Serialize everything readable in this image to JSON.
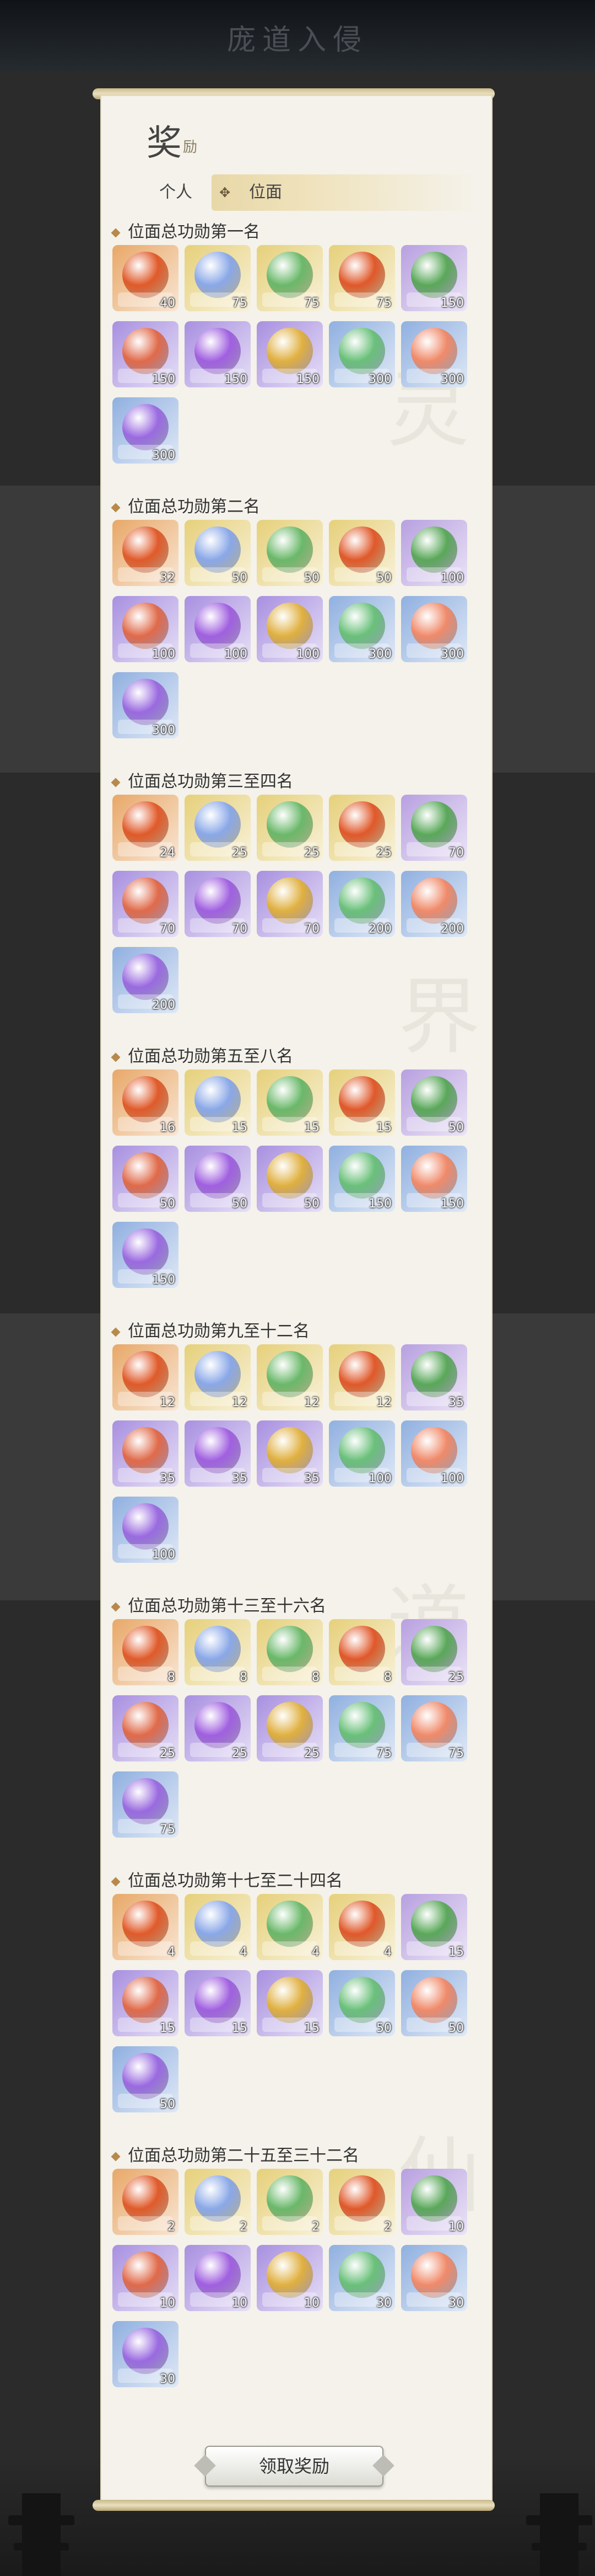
{
  "background_title": "庞道入侵",
  "panel": {
    "title": "奖",
    "subtitle": "励"
  },
  "tabs": [
    {
      "label": "个人",
      "selected": false
    },
    {
      "label": "位面",
      "selected": true,
      "icon": "four-petal-icon"
    }
  ],
  "sections": [
    {
      "title": "位面总功勋第一名",
      "counts": [
        "40",
        "75",
        "75",
        "75",
        "150",
        "150",
        "150",
        "150",
        "300",
        "300",
        "300"
      ]
    },
    {
      "title": "位面总功勋第二名",
      "counts": [
        "32",
        "50",
        "50",
        "50",
        "100",
        "100",
        "100",
        "100",
        "300",
        "300",
        "300"
      ]
    },
    {
      "title": "位面总功勋第三至四名",
      "counts": [
        "24",
        "25",
        "25",
        "25",
        "70",
        "70",
        "70",
        "70",
        "200",
        "200",
        "200"
      ]
    },
    {
      "title": "位面总功勋第五至八名",
      "counts": [
        "16",
        "15",
        "15",
        "15",
        "50",
        "50",
        "50",
        "50",
        "150",
        "150",
        "150"
      ]
    },
    {
      "title": "位面总功勋第九至十二名",
      "counts": [
        "12",
        "12",
        "12",
        "12",
        "35",
        "35",
        "35",
        "35",
        "100",
        "100",
        "100"
      ]
    },
    {
      "title": "位面总功勋第十三至十六名",
      "counts": [
        "8",
        "8",
        "8",
        "8",
        "25",
        "25",
        "25",
        "25",
        "75",
        "75",
        "75"
      ]
    },
    {
      "title": "位面总功勋第十七至二十四名",
      "counts": [
        "4",
        "4",
        "4",
        "4",
        "15",
        "15",
        "15",
        "15",
        "50",
        "50",
        "50"
      ]
    },
    {
      "title": "位面总功勋第二十五至三十二名",
      "counts": [
        "2",
        "2",
        "2",
        "2",
        "10",
        "10",
        "10",
        "10",
        "30",
        "30",
        "30"
      ]
    }
  ],
  "items": [
    {
      "icon": "red-lotus-icon",
      "frame": "#e8a868",
      "color": "#e05a2a"
    },
    {
      "icon": "blue-orb-bowl-icon",
      "frame": "#e6d07a",
      "color": "#8aa8e8"
    },
    {
      "icon": "green-orb-bowl-icon",
      "frame": "#e6d07a",
      "color": "#6ab86a"
    },
    {
      "icon": "red-orb-bowl-icon",
      "frame": "#e6d07a",
      "color": "#e0582a"
    },
    {
      "icon": "green-gem-chest-icon",
      "frame": "#b8a0e0",
      "color": "#5aa85a"
    },
    {
      "icon": "red-gem-chest-icon",
      "frame": "#a890e0",
      "color": "#e06a4a"
    },
    {
      "icon": "purple-gem-chest-icon",
      "frame": "#a890e0",
      "color": "#a060e0"
    },
    {
      "icon": "gold-gem-chest-icon",
      "frame": "#a890e0",
      "color": "#e0b040"
    },
    {
      "icon": "green-orb-lotus-icon",
      "frame": "#90b0e0",
      "color": "#6ac07a"
    },
    {
      "icon": "orange-orb-lotus-icon",
      "frame": "#90b0e0",
      "color": "#f08a6a"
    },
    {
      "icon": "purple-orb-lotus-icon",
      "frame": "#90b0e0",
      "color": "#9a6ae0"
    }
  ],
  "claim_button": {
    "label": "领取奖励"
  }
}
